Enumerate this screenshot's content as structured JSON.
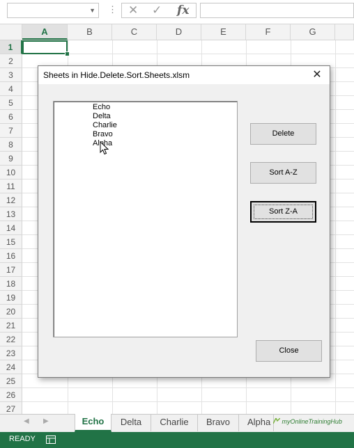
{
  "formula_bar": {
    "name_box_value": "",
    "cancel_icon": "✕",
    "enter_icon": "✓",
    "function_label": "fx",
    "formula_value": ""
  },
  "columns": [
    "A",
    "B",
    "C",
    "D",
    "E",
    "F",
    "G"
  ],
  "selected_column": "A",
  "rows": [
    "1",
    "2",
    "3",
    "4",
    "5",
    "6",
    "7",
    "8",
    "9",
    "10",
    "11",
    "12",
    "13",
    "14",
    "15",
    "16",
    "17",
    "18",
    "19",
    "20",
    "21",
    "22",
    "23",
    "24",
    "25",
    "26",
    "27"
  ],
  "selected_row": "1",
  "dialog": {
    "title": "Sheets in Hide.Delete.Sort.Sheets.xlsm",
    "close_label": "✕",
    "list_items": [
      "Echo",
      "Delta",
      "Charlie",
      "Bravo",
      "Alpha"
    ],
    "buttons": {
      "delete": "Delete",
      "sort_az": "Sort A-Z",
      "sort_za": "Sort Z-A",
      "close": "Close"
    }
  },
  "sheet_tabs": [
    "Echo",
    "Delta",
    "Charlie",
    "Bravo",
    "Alpha"
  ],
  "active_sheet": "Echo",
  "watermark": "myOnlineTrainingHub",
  "status": {
    "ready": "READY"
  },
  "colors": {
    "excel_green": "#217346",
    "dialog_bg": "#f0f0f0"
  }
}
